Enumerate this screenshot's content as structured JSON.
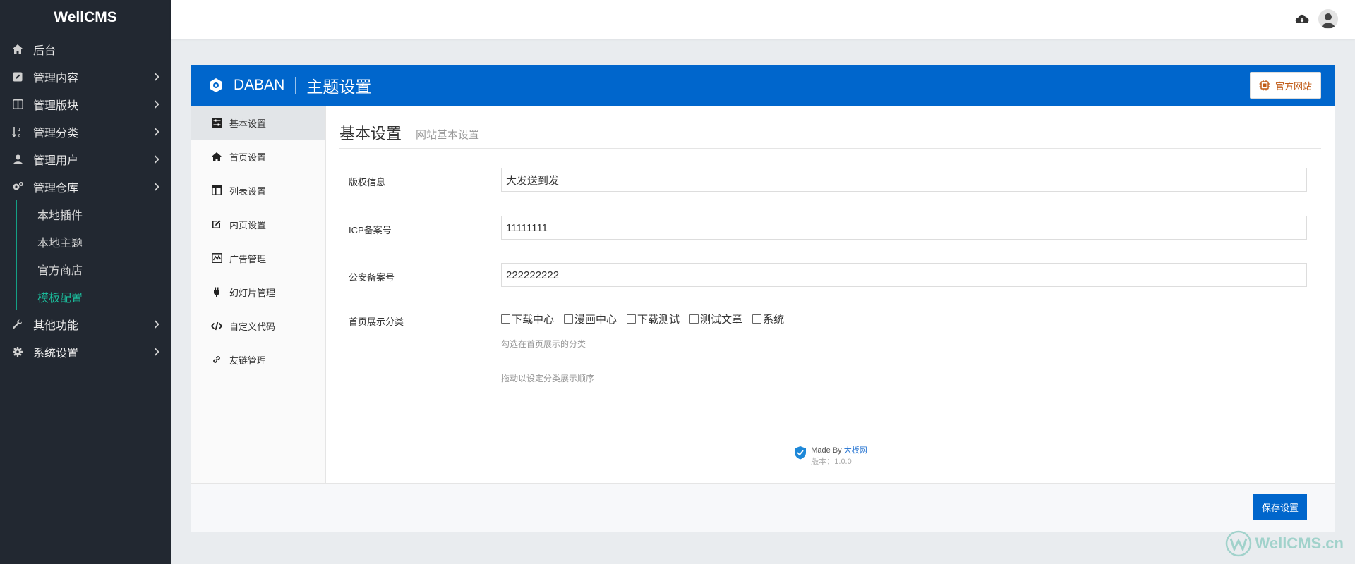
{
  "sidebar": {
    "brand": "WellCMS",
    "items": [
      {
        "label": "后台",
        "icon": "home-icon"
      },
      {
        "label": "管理内容",
        "icon": "edit-icon"
      },
      {
        "label": "管理版块",
        "icon": "columns-icon"
      },
      {
        "label": "管理分类",
        "icon": "sort-icon"
      },
      {
        "label": "管理用户",
        "icon": "user-icon"
      },
      {
        "label": "管理仓库",
        "icon": "gears-icon"
      }
    ],
    "subitems": [
      "本地插件",
      "本地主题",
      "官方商店",
      "模板配置"
    ],
    "bottom_items": [
      {
        "label": "其他功能",
        "icon": "wrench-icon"
      },
      {
        "label": "系统设置",
        "icon": "gear-icon"
      }
    ]
  },
  "panel": {
    "brand": "DABAN",
    "title": "主题设置",
    "official_label": "官方网站"
  },
  "menu": [
    "基本设置",
    "首页设置",
    "列表设置",
    "内页设置",
    "广告管理",
    "幻灯片管理",
    "自定义代码",
    "友链管理"
  ],
  "section": {
    "title": "基本设置",
    "subtitle": "网站基本设置"
  },
  "form": {
    "copyright_label": "版权信息",
    "copyright_value": "大发送到发",
    "icp_label": "ICP备案号",
    "icp_value": "11111111",
    "police_label": "公安备案号",
    "police_value": "222222222",
    "categories_label": "首页展示分类",
    "categories": [
      "下载中心",
      "漫画中心",
      "下载测试",
      "测试文章",
      "系统"
    ],
    "hint1": "勾选在首页展示的分类",
    "hint2": "拖动以设定分类展示顺序"
  },
  "made_by": {
    "prefix": "Made By ",
    "link": "大板网",
    "version": "版本：1.0.0"
  },
  "footer": {
    "save_label": "保存设置"
  },
  "watermark": "WellCMS.cn",
  "colors": {
    "sidebar_bg": "#222831",
    "accent_blue": "#0066cc",
    "active_green": "#1bbc9b"
  }
}
